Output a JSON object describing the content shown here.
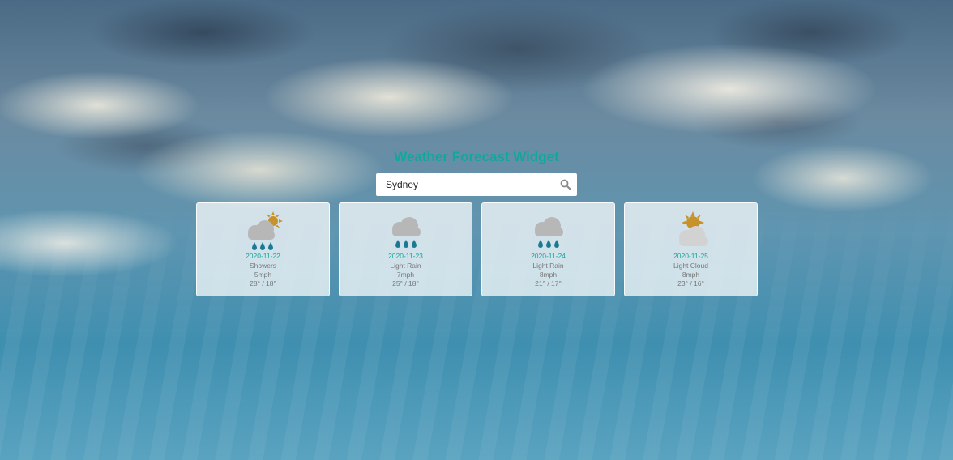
{
  "title": "Weather Forecast Widget",
  "search": {
    "value": "Sydney",
    "icon": "search-icon"
  },
  "colors": {
    "accent": "#0fa89a",
    "cloud": "#b7b7b7",
    "rain": "#1a7a93",
    "sun": "#c8922a",
    "muted_text": "#777777"
  },
  "forecast": [
    {
      "date": "2020-11-22",
      "description": "Showers",
      "wind": "5mph",
      "high": "28°",
      "low": "18°",
      "icon": "showers-icon"
    },
    {
      "date": "2020-11-23",
      "description": "Light Rain",
      "wind": "7mph",
      "high": "25°",
      "low": "18°",
      "icon": "light-rain-icon"
    },
    {
      "date": "2020-11-24",
      "description": "Light Rain",
      "wind": "8mph",
      "high": "21°",
      "low": "17°",
      "icon": "light-rain-icon"
    },
    {
      "date": "2020-11-25",
      "description": "Light Cloud",
      "wind": "8mph",
      "high": "23°",
      "low": "16°",
      "icon": "light-cloud-icon"
    }
  ],
  "temp_separator": " / "
}
